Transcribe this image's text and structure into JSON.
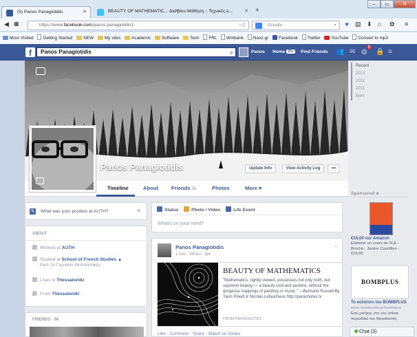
{
  "browser": {
    "tabs": [
      {
        "title": "(5) Panos Panagiotidis",
        "color": "#3b5998"
      },
      {
        "title": "BEAUTY OF MATHEMATIC...",
        "color": "#44bbff"
      },
      {
        "title": "Δια βίου Μάθηση :: Τεχνικές κ...",
        "color": ""
      }
    ],
    "new_tab": "+",
    "url_prefix": "https://www.",
    "url_domain": "facebook.com",
    "url_path": "/panos.panagiotidis3",
    "search_placeholder": "Google",
    "bookmarks": [
      "Most Visited",
      "Getting Started",
      "NEW",
      "My sites",
      "Academic",
      "Software",
      "Tech",
      "FRL",
      "Winbank",
      "Nooz.gr",
      "Facebook",
      "Twitter",
      "YouTube",
      "Convert to mp3"
    ]
  },
  "fb": {
    "search_value": "Panos Panagiotidis",
    "user": "Panos",
    "home": "Home",
    "home_count": "20+",
    "find_friends": "Find Friends",
    "notif_count": "5"
  },
  "profile": {
    "name": "Panos Panagiotidis",
    "update_info": "Update Info",
    "activity_log": "View Activity Log",
    "more_dots": "•••"
  },
  "tabs": {
    "timeline": "Timeline",
    "about": "About",
    "friends": "Friends",
    "friends_count": "56",
    "photos": "Photos",
    "more": "More ▾"
  },
  "years": [
    "Recent",
    "2013",
    "2012",
    "2011",
    "Born"
  ],
  "left": {
    "question": "What was your position at AUTH?",
    "about_title": "ABOUT",
    "worked_prefix": "Worked at ",
    "worked_at": "AUTH",
    "studied_prefix": "Studied at ",
    "studied_at": "School of French Studies",
    "studied_past": "Past: 2ο Γυμνάσιο Θεσσαλονίκης",
    "lives_prefix": "Lives in ",
    "lives_in": "Thessaloniki",
    "from_prefix": "From ",
    "from": "Thessaloniki",
    "friends_title": "FRIENDS · 56"
  },
  "composer": {
    "status": "Status",
    "photo_video": "Photo / Video",
    "life_event": "Life Event",
    "placeholder": "What's on your mind?"
  },
  "post": {
    "author": "Panos Panagiotidis",
    "meta": "1 min · Vimeo · ",
    "embed_title": "BEAUTY OF MATHEMATICS",
    "embed_text": "\"Mathematics, rightly viewed, possesses not only truth, but supreme beauty — a beauty cold and austere, without the gorgeous trappings of painting or music.\" —Bertrand Russell By Yann Pineill & Nicolas Lefaucheux http://parachutes.tv",
    "embed_source": "FROM PARACHUTES",
    "actions": "Like · Comment · Share · Watch on Vimeo"
  },
  "sidebar": {
    "sponsored": "Sponsored",
    "ad1_price": "€15,00 sur Amazon",
    "ad1_text": "Elaborer un cours de FLE - Broché - Janine Courtillon - €15,00",
    "ad2_logo": "BOMBPLUS",
    "ad2_title": "Το κολιέτσο του BOMBPLUS",
    "ad2_url": "www.newsbomb.gr/bombplus",
    "ad2_text": "Εσύ μπήκες στο νέο online περιοδικό του Newsbomb;",
    "chat": "Chat (3)"
  }
}
